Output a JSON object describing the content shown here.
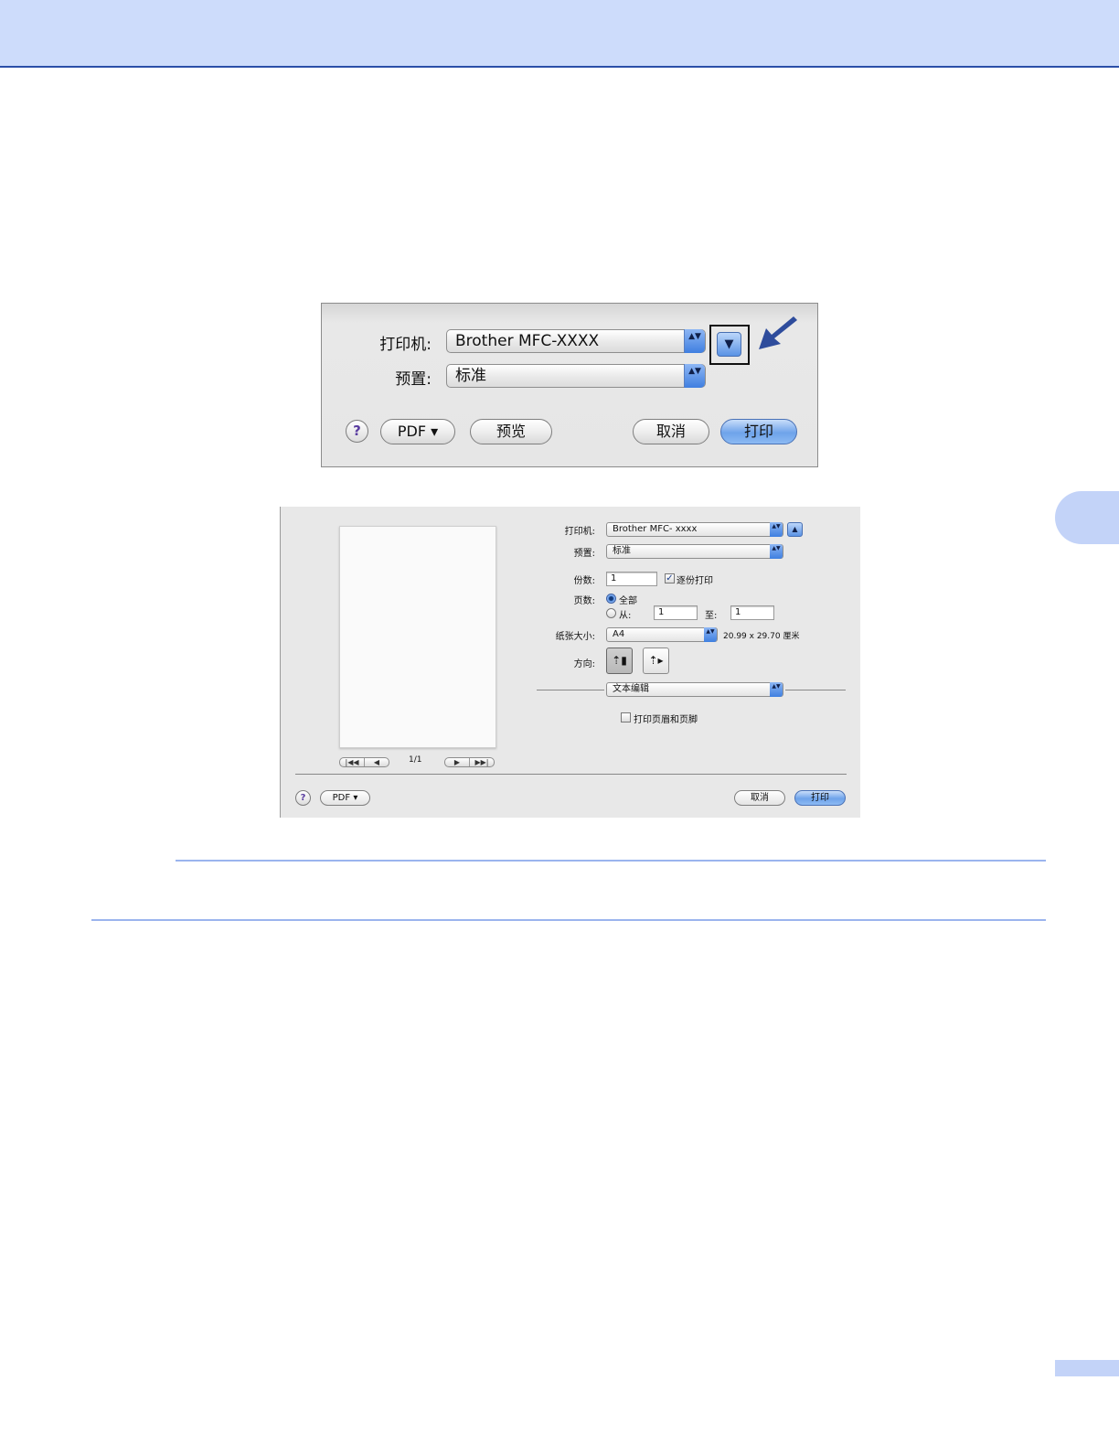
{
  "dialog_collapsed": {
    "printer_label": "打印机:",
    "printer_value": "Brother MFC-XXXX",
    "presets_label": "预置:",
    "presets_value": "标准",
    "disclosure_glyph": "▼",
    "help_glyph": "?",
    "pdf_button": "PDF ▾",
    "preview_button": "预览",
    "cancel_button": "取消",
    "print_button": "打印",
    "popup_arrows": "▲▼"
  },
  "dialog_expanded": {
    "printer_label": "打印机:",
    "printer_value": "Brother MFC- xxxx",
    "disclosure_glyph": "▲",
    "presets_label": "预置:",
    "presets_value": "标准",
    "copies_label": "份数:",
    "copies_value": "1",
    "collated_label": "逐份打印",
    "collated_checked": true,
    "pages_label": "页数:",
    "pages_all_label": "全部",
    "pages_from_label": "从:",
    "pages_from_value": "1",
    "pages_to_label": "至:",
    "pages_to_value": "1",
    "paper_size_label": "纸张大小:",
    "paper_size_value": "A4",
    "paper_dimensions": "20.99 x 29.70 厘米",
    "orientation_label": "方向:",
    "orientation_selected": "portrait",
    "app_pane_value": "文本编辑",
    "header_footer_label": "打印页眉和页脚",
    "header_footer_checked": false,
    "page_counter": "1/1",
    "nav_first": "|◀◀",
    "nav_prev": "◀",
    "nav_next": "▶",
    "nav_last": "▶▶|",
    "help_glyph": "?",
    "pdf_button": "PDF ▾",
    "cancel_button": "取消",
    "print_button": "打印",
    "check_glyph": "✓",
    "popup_arrows": "▲▼"
  },
  "colors": {
    "header_band": "#cddcfb",
    "header_line": "#2b4fa8",
    "accent_arrow": "#2e4c9c",
    "rule": "#9bb4ee"
  }
}
